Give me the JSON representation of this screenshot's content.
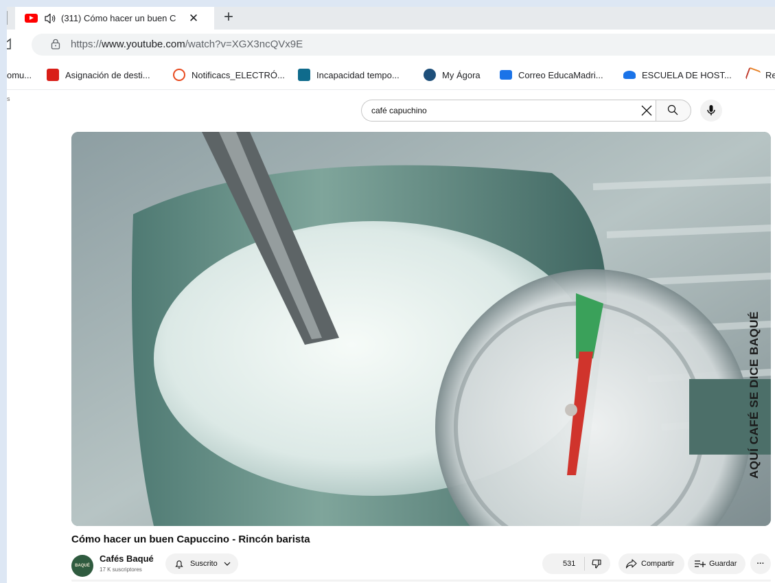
{
  "browser": {
    "tab_title": "(311) Cómo hacer un buen C",
    "tab_close": "✕",
    "new_tab": "+",
    "url_scheme": "https://",
    "url_host": "www.youtube.com",
    "url_path": "/watch?v=XGX3ncQVx9E"
  },
  "bookmarks": [
    {
      "label": "omu...",
      "icon_color": "none"
    },
    {
      "label": "Asignación de desti...",
      "icon_color": "#d91e18"
    },
    {
      "label": "Notificacs_ELECTRÓ...",
      "icon_color": "#e8491d"
    },
    {
      "label": "Incapacidad tempo...",
      "icon_color": "#0f6b8c"
    },
    {
      "label": "My Ágora",
      "icon_color": "#1e4f7a"
    },
    {
      "label": "Correo EducaMadri...",
      "icon_color": "#1a73e8"
    },
    {
      "label": "ESCUELA DE HOST...",
      "icon_color": "#1a73e8"
    },
    {
      "label": "Re",
      "icon_color": "#c0392b"
    }
  ],
  "youtube": {
    "left_fragment": "s",
    "search_value": "café capuchino",
    "video": {
      "brand_overlay": "AQUÍ CAFÉ SE DICE BAQUÉ",
      "title": "Cómo hacer un buen Capuccino - Rincón barista"
    },
    "channel": {
      "avatar_text": "BAQUÉ",
      "name": "Cafés Baqué",
      "subscribers": "17 K suscriptores"
    },
    "actions": {
      "subscribed_label": "Suscrito",
      "like_count": "531",
      "share_label": "Compartir",
      "save_label": "Guardar",
      "more_label": "···"
    }
  }
}
